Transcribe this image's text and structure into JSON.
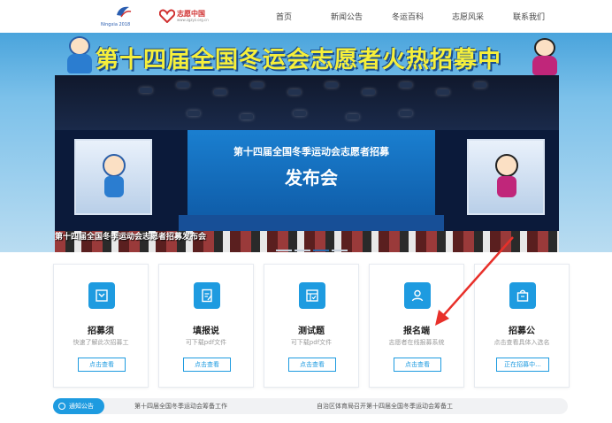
{
  "nav": {
    "logo_text": "Ningxia 2018",
    "logo2_text": "志愿中国",
    "logo2_sub": "www.zgzyz.org.cn",
    "items": [
      {
        "label": "首页"
      },
      {
        "label": "新闻公告"
      },
      {
        "label": "冬运百科"
      },
      {
        "label": "志愿风采"
      },
      {
        "label": "联系我们"
      }
    ]
  },
  "banner": {
    "title": "第十四届全国冬运会志愿者火热招募中",
    "screen_line1": "第十四届全国冬季运动会志愿者招募",
    "screen_line2": "发布会",
    "caption": "第十四届全国冬季运动会志愿者招募发布会",
    "slides": 4,
    "active_slide": 3
  },
  "cards": [
    {
      "title": "招募须",
      "desc": "快速了解此次招募工",
      "button": "点击查看",
      "icon": "flag-icon"
    },
    {
      "title": "填报说",
      "desc": "可下载pdf文件",
      "button": "点击查看",
      "icon": "edit-document-icon"
    },
    {
      "title": "测试题",
      "desc": "可下载pdf文件",
      "button": "点击查看",
      "icon": "quiz-icon"
    },
    {
      "title": "报名端",
      "desc": "志愿者在线报募系统",
      "button": "点击查看",
      "icon": "user-icon"
    },
    {
      "title": "招募公",
      "desc": "点击查看具体入选名",
      "button": "正在招募中...",
      "icon": "bag-icon"
    }
  ],
  "notice": {
    "tag": "通知公告",
    "items": [
      {
        "text": "第十四届全国冬季运动会筹备工作"
      },
      {
        "text": "自治区体育局召开第十四届全国冬季运动会筹备工"
      }
    ]
  },
  "colors": {
    "accent": "#1e9be0",
    "banner_title": "#f6ef3b",
    "arrow": "#e8302a"
  }
}
